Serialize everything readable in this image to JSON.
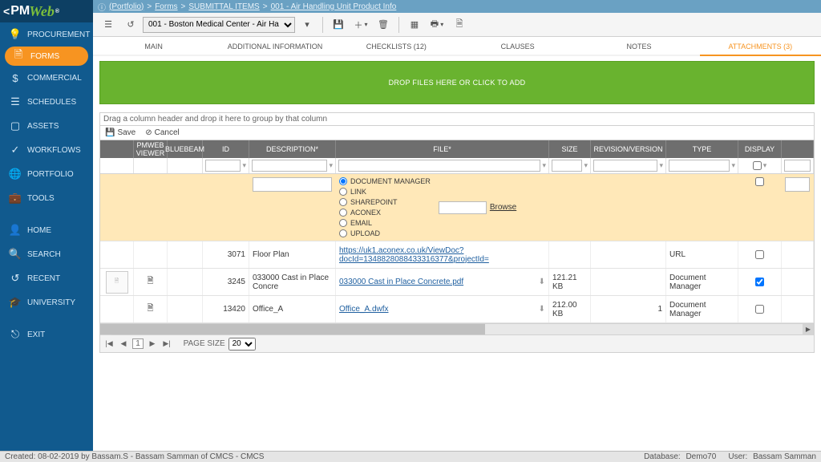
{
  "brand": {
    "text": "PMWeb"
  },
  "breadcrumb": {
    "portfolio": "(Portfolio)",
    "forms": "Forms",
    "submittal": "SUBMITTAL ITEMS",
    "item": "001 - Air Handling Unit Product Info"
  },
  "toolbar": {
    "project": "001 - Boston Medical Center - Air Ha"
  },
  "tabs": {
    "main": "MAIN",
    "additional": "ADDITIONAL INFORMATION",
    "checklists": "CHECKLISTS (12)",
    "clauses": "CLAUSES",
    "notes": "NOTES",
    "attachments": "ATTACHMENTS (3)"
  },
  "dropzone": "DROP FILES HERE OR CLICK TO ADD",
  "grid": {
    "group_hint": "Drag a column header and drop it here to group by that column",
    "save": "Save",
    "cancel": "Cancel",
    "headers": {
      "pmweb": "PMWEB VIEWER",
      "bluebeam": "BLUEBEAM",
      "id": "ID",
      "description": "DESCRIPTION*",
      "file": "FILE*",
      "size": "SIZE",
      "revision": "REVISION/VERSION",
      "type": "TYPE",
      "display": "DISPLAY"
    },
    "edit": {
      "options": {
        "document_manager": "DOCUMENT MANAGER",
        "link": "LINK",
        "sharepoint": "SHAREPOINT",
        "aconex": "ACONEX",
        "email": "EMAIL",
        "upload": "UPLOAD"
      },
      "browse": "Browse"
    },
    "rows": [
      {
        "id": "3071",
        "description": "Floor Plan",
        "file": "https://uk1.aconex.co.uk/ViewDoc?docId=1348828088433316377&projectId=",
        "size": "",
        "revision": "",
        "type": "URL",
        "display": false
      },
      {
        "id": "3245",
        "description": "033000 Cast in Place Concre",
        "file": "033000 Cast in Place Concrete.pdf",
        "size": "121.21 KB",
        "revision": "",
        "type": "Document Manager",
        "display": true
      },
      {
        "id": "13420",
        "description": "Office_A",
        "file": "Office_A.dwfx",
        "size": "212.00 KB",
        "revision": "1",
        "type": "Document Manager",
        "display": false
      }
    ]
  },
  "pager": {
    "page": "1",
    "label": "PAGE SIZE",
    "size": "20"
  },
  "sidebar": {
    "items": [
      {
        "label": "PROCUREMENT"
      },
      {
        "label": "FORMS"
      },
      {
        "label": "COMMERCIAL"
      },
      {
        "label": "SCHEDULES"
      },
      {
        "label": "ASSETS"
      },
      {
        "label": "WORKFLOWS"
      },
      {
        "label": "PORTFOLIO"
      },
      {
        "label": "TOOLS"
      },
      {
        "label": "HOME"
      },
      {
        "label": "SEARCH"
      },
      {
        "label": "RECENT"
      },
      {
        "label": "UNIVERSITY"
      },
      {
        "label": "EXIT"
      }
    ]
  },
  "statusbar": {
    "created": "Created:  08-02-2019 by Bassam.S - Bassam Samman of CMCS - CMCS",
    "db_label": "Database:",
    "db": "Demo70",
    "user_label": "User:",
    "user": "Bassam Samman"
  }
}
